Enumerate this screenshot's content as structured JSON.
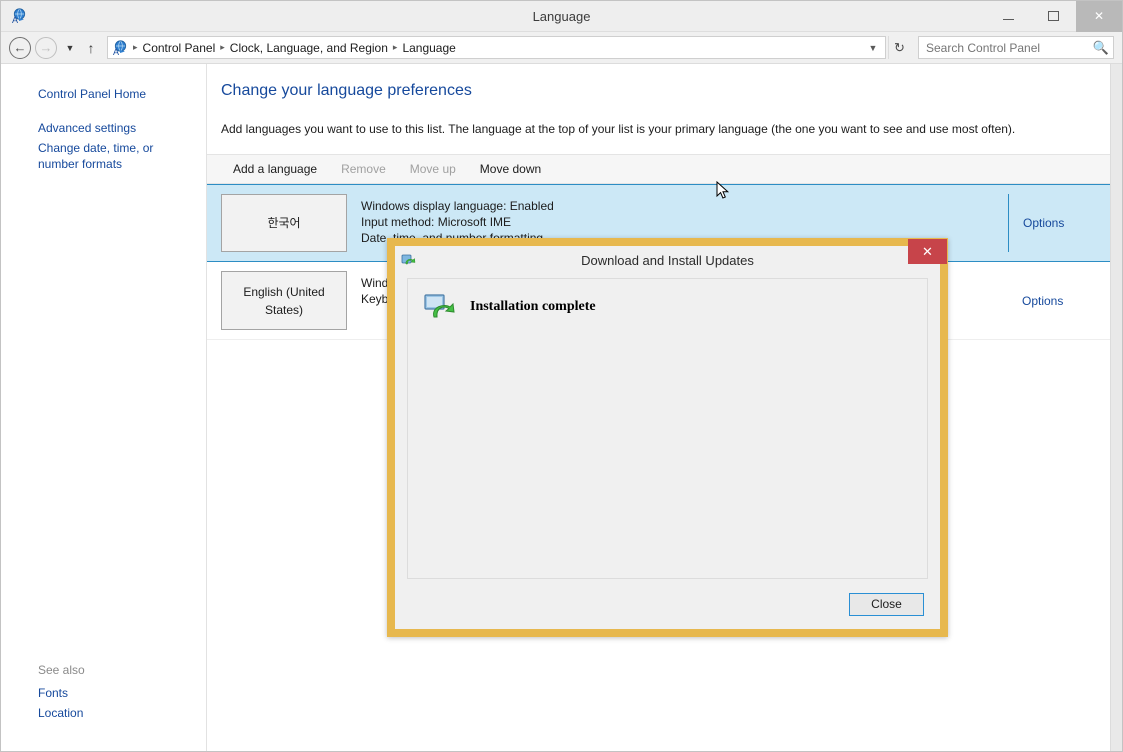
{
  "window": {
    "title": "Language",
    "icon": "language-globe-icon",
    "minimize_label": "Minimize",
    "maximize_label": "Maximize",
    "close_label": "Close"
  },
  "nav": {
    "back_label": "Back",
    "forward_label": "Forward",
    "recent_label": "Recent locations",
    "up_label": "Up",
    "refresh_label": "Refresh",
    "dropdown_label": "Previous locations",
    "breadcrumbs": [
      "Control Panel",
      "Clock, Language, and Region",
      "Language"
    ],
    "separator": "▸"
  },
  "search": {
    "placeholder": "Search Control Panel",
    "value": "",
    "icon": "search-icon"
  },
  "sidebar": {
    "items": [
      {
        "label": "Control Panel Home"
      },
      {
        "label": "Advanced settings"
      },
      {
        "label": "Change date, time, or number formats"
      }
    ],
    "see_also_heading": "See also",
    "see_also": [
      {
        "label": "Fonts"
      },
      {
        "label": "Location"
      }
    ]
  },
  "main": {
    "title": "Change your language preferences",
    "description": "Add languages you want to use to this list. The language at the top of your list is your primary language (the one you want to see and use most often).",
    "toolbar": [
      {
        "label": "Add a language",
        "enabled": true
      },
      {
        "label": "Remove",
        "enabled": false
      },
      {
        "label": "Move up",
        "enabled": false
      },
      {
        "label": "Move down",
        "enabled": true
      }
    ],
    "languages": [
      {
        "name": "한국어",
        "details": "Windows display language: Enabled\nInput method: Microsoft IME\nDate, time, and number formatting",
        "options_label": "Options",
        "selected": true
      },
      {
        "name": "English (United States)",
        "details": "Windows display language: Available\nKeyboard layout: US",
        "options_label": "Options",
        "selected": false
      }
    ]
  },
  "dialog": {
    "title": "Download and Install Updates",
    "icon": "update-globe-icon",
    "status_icon": "install-monitor-refresh-icon",
    "status_text": "Installation complete",
    "close_button_label": "Close",
    "titlebar_close_label": "✕",
    "border_color": "#e7b84e",
    "close_color": "#c7444a"
  }
}
